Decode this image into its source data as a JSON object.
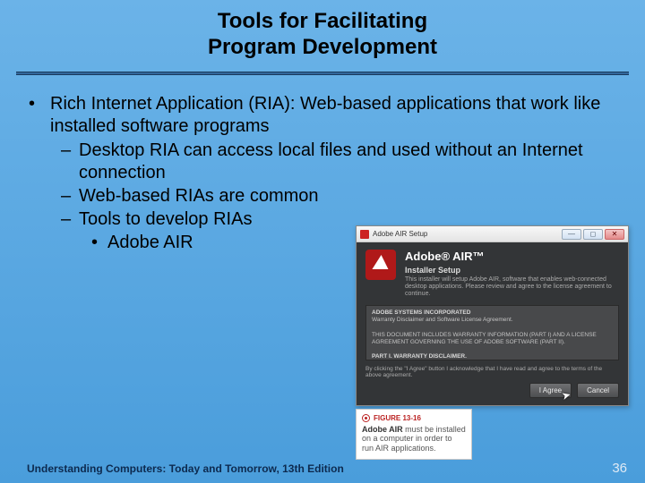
{
  "title_line1": "Tools for Facilitating",
  "title_line2": "Program Development",
  "bullets": {
    "l1": "Rich Internet Application (RIA): Web-based applications that work like installed software programs",
    "l2a": "Desktop RIA can access local files and used without an Internet connection",
    "l2b": "Web-based RIAs are common",
    "l2c": "Tools to develop RIAs",
    "l3a": "Adobe AIR"
  },
  "installer": {
    "titlebar": "Adobe AIR Setup",
    "brand": "Adobe® AIR™",
    "subhead": "Installer Setup",
    "desc": "This installer will setup Adobe AIR, software that enables web-connected desktop applications. Please review and agree to the license agreement to continue.",
    "license_head": "ADOBE SYSTEMS INCORPORATED",
    "license_sub": "Warranty Disclaimer and Software License Agreement.",
    "license_body1": "THIS DOCUMENT INCLUDES WARRANTY INFORMATION (PART I) AND A LICENSE AGREEMENT GOVERNING THE USE OF ADOBE SOFTWARE (PART II).",
    "license_body2": "PART I. WARRANTY DISCLAIMER.",
    "footer_note": "By clicking the \"I Agree\" button I acknowledge that I have read and agree to the terms of the above agreement.",
    "btn_agree": "I Agree",
    "btn_cancel": "Cancel"
  },
  "caption": {
    "figure_label": "FIGURE 13-16",
    "title": "Adobe AIR",
    "body": " must be installed on a computer in order to run AIR applications."
  },
  "footer": {
    "left": "Understanding Computers: Today and Tomorrow, 13th Edition",
    "page": "36"
  }
}
